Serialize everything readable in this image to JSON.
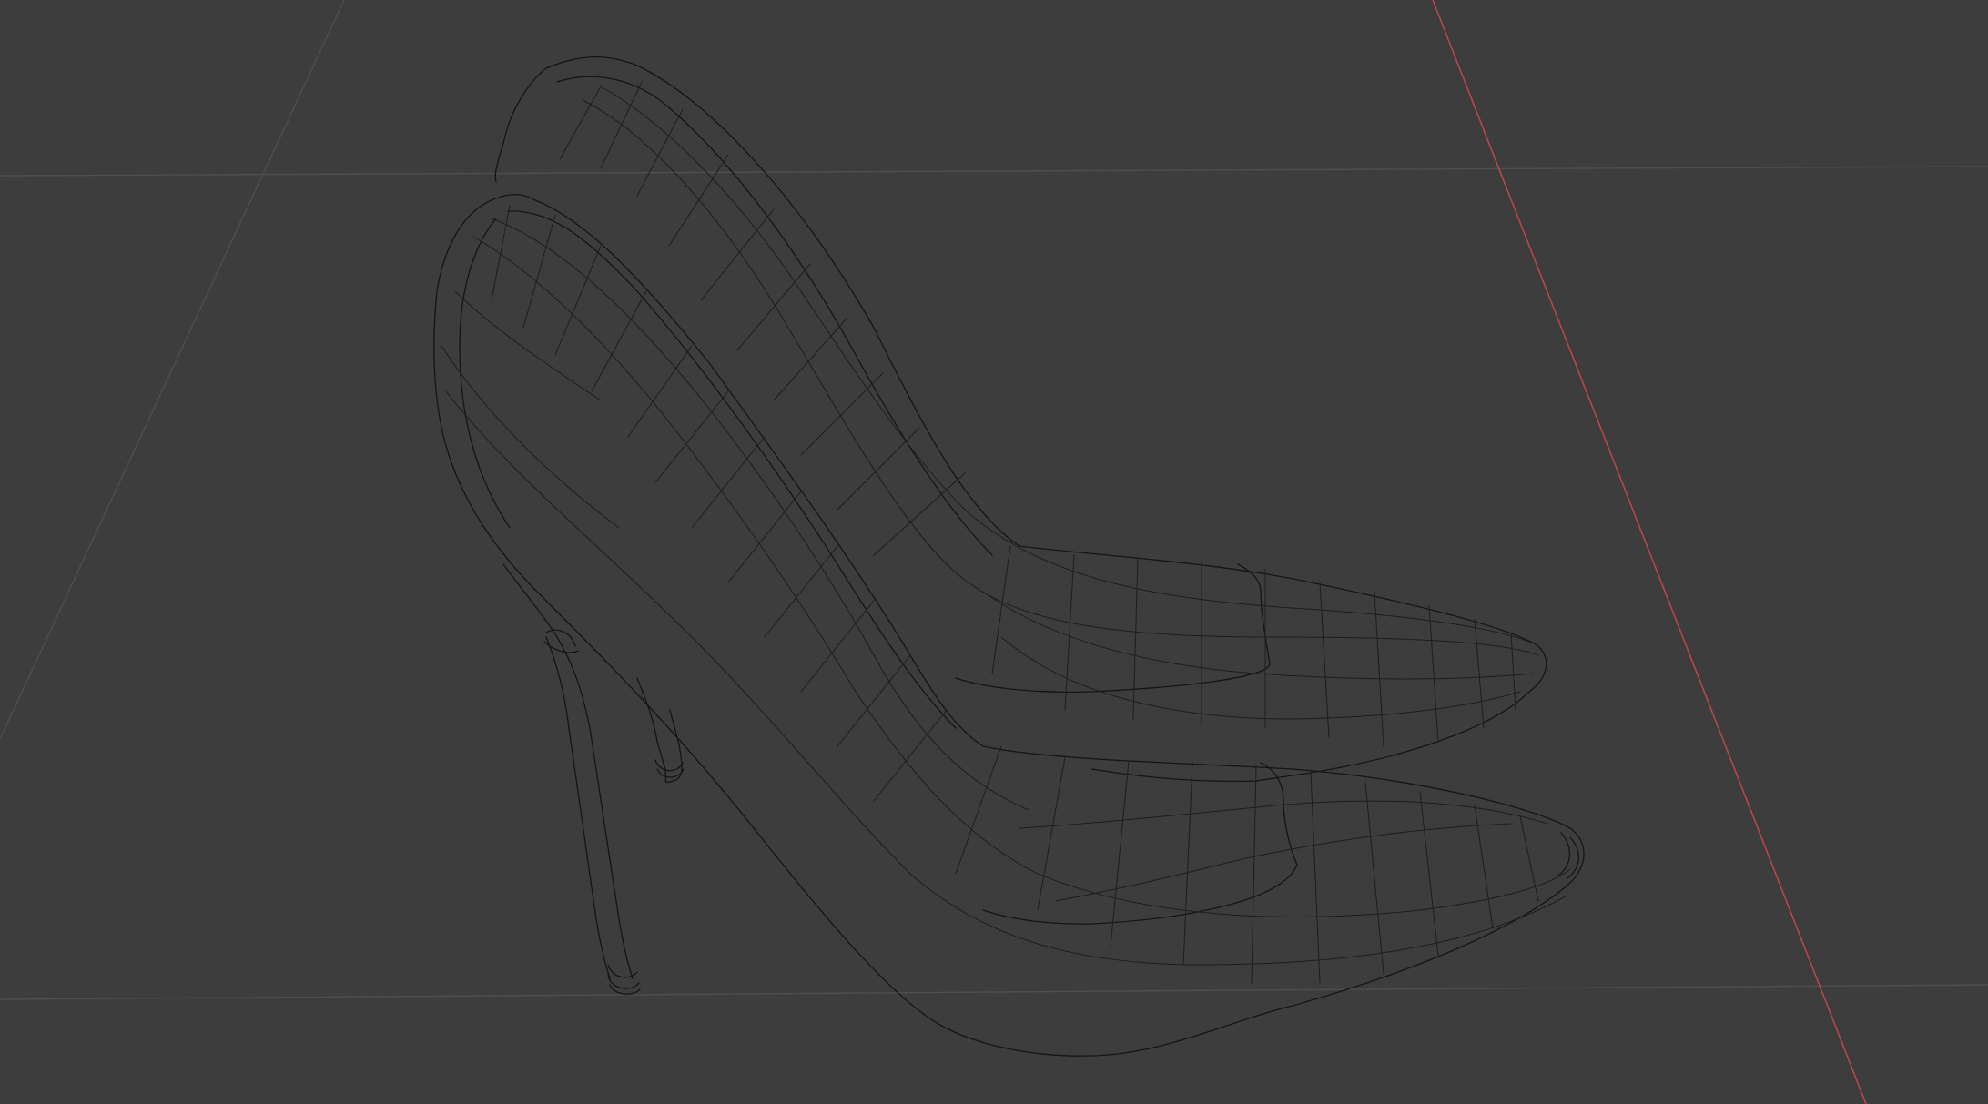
{
  "viewport": {
    "background_color": "#3d3d3d",
    "grid_color": "#4e4e4e",
    "x_axis_color": "#b8454f",
    "wire_color": "#151515",
    "display_mode": "wireframe",
    "objects": [
      {
        "name": "high-heel-shoe-back"
      },
      {
        "name": "high-heel-shoe-front"
      }
    ]
  }
}
